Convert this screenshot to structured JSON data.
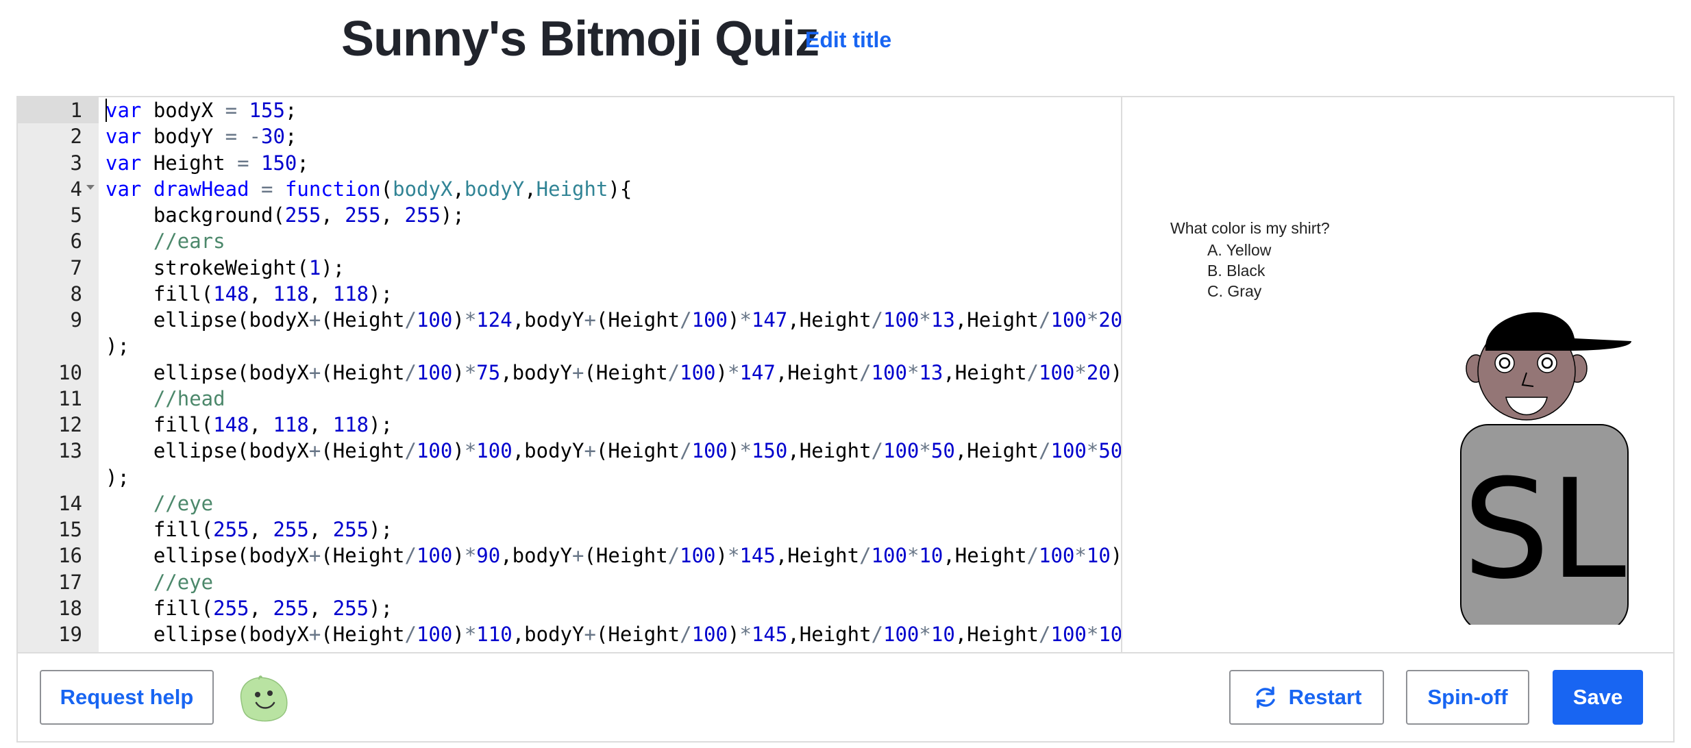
{
  "header": {
    "title": "Sunny's Bitmoji Quiz",
    "edit_title_label": "Edit title"
  },
  "editor": {
    "lines": [
      {
        "n": "1",
        "html": "<span class=\"kw\">var</span> bodyX <span class=\"op\">=</span> <span class=\"num\">155</span>;"
      },
      {
        "n": "2",
        "html": "<span class=\"kw\">var</span> bodyY <span class=\"op\">=</span> <span class=\"op\">-</span><span class=\"num\">30</span>;"
      },
      {
        "n": "3",
        "html": "<span class=\"kw\">var</span> Height <span class=\"op\">=</span> <span class=\"num\">150</span>;"
      },
      {
        "n": "4",
        "html": "<span class=\"kw\">var</span> <span class=\"kw\">drawHead</span> <span class=\"op\">=</span> <span class=\"kw\">function</span>(<span class=\"param\">bodyX</span>,<span class=\"param\">bodyY</span>,<span class=\"param\">Height</span>){"
      },
      {
        "n": "5",
        "html": "    background(<span class=\"num\">255</span>, <span class=\"num\">255</span>, <span class=\"num\">255</span>);"
      },
      {
        "n": "6",
        "html": "    <span class=\"cmt\">//ears</span>"
      },
      {
        "n": "7",
        "html": "    strokeWeight(<span class=\"num\">1</span>);"
      },
      {
        "n": "8",
        "html": "    fill(<span class=\"num\">148</span>, <span class=\"num\">118</span>, <span class=\"num\">118</span>);"
      },
      {
        "n": "9",
        "html": "    ellipse(bodyX<span class=\"op\">+</span>(Height<span class=\"op\">/</span><span class=\"num\">100</span>)<span class=\"op\">*</span><span class=\"num\">124</span>,bodyY<span class=\"op\">+</span>(Height<span class=\"op\">/</span><span class=\"num\">100</span>)<span class=\"op\">*</span><span class=\"num\">147</span>,Height<span class=\"op\">/</span><span class=\"num\">100</span><span class=\"op\">*</span><span class=\"num\">13</span>,Height<span class=\"op\">/</span><span class=\"num\">100</span><span class=\"op\">*</span><span class=\"num\">20</span>",
        "wrap": ");"
      },
      {
        "n": "10",
        "html": "    ellipse(bodyX<span class=\"op\">+</span>(Height<span class=\"op\">/</span><span class=\"num\">100</span>)<span class=\"op\">*</span><span class=\"num\">75</span>,bodyY<span class=\"op\">+</span>(Height<span class=\"op\">/</span><span class=\"num\">100</span>)<span class=\"op\">*</span><span class=\"num\">147</span>,Height<span class=\"op\">/</span><span class=\"num\">100</span><span class=\"op\">*</span><span class=\"num\">13</span>,Height<span class=\"op\">/</span><span class=\"num\">100</span><span class=\"op\">*</span><span class=\"num\">20</span>);"
      },
      {
        "n": "11",
        "html": "    <span class=\"cmt\">//head</span>"
      },
      {
        "n": "12",
        "html": "    fill(<span class=\"num\">148</span>, <span class=\"num\">118</span>, <span class=\"num\">118</span>);"
      },
      {
        "n": "13",
        "html": "    ellipse(bodyX<span class=\"op\">+</span>(Height<span class=\"op\">/</span><span class=\"num\">100</span>)<span class=\"op\">*</span><span class=\"num\">100</span>,bodyY<span class=\"op\">+</span>(Height<span class=\"op\">/</span><span class=\"num\">100</span>)<span class=\"op\">*</span><span class=\"num\">150</span>,Height<span class=\"op\">/</span><span class=\"num\">100</span><span class=\"op\">*</span><span class=\"num\">50</span>,Height<span class=\"op\">/</span><span class=\"num\">100</span><span class=\"op\">*</span><span class=\"num\">50</span>",
        "wrap": ");"
      },
      {
        "n": "14",
        "html": "    <span class=\"cmt\">//eye</span>"
      },
      {
        "n": "15",
        "html": "    fill(<span class=\"num\">255</span>, <span class=\"num\">255</span>, <span class=\"num\">255</span>);"
      },
      {
        "n": "16",
        "html": "    ellipse(bodyX<span class=\"op\">+</span>(Height<span class=\"op\">/</span><span class=\"num\">100</span>)<span class=\"op\">*</span><span class=\"num\">90</span>,bodyY<span class=\"op\">+</span>(Height<span class=\"op\">/</span><span class=\"num\">100</span>)<span class=\"op\">*</span><span class=\"num\">145</span>,Height<span class=\"op\">/</span><span class=\"num\">100</span><span class=\"op\">*</span><span class=\"num\">10</span>,Height<span class=\"op\">/</span><span class=\"num\">100</span><span class=\"op\">*</span><span class=\"num\">10</span>);"
      },
      {
        "n": "17",
        "html": "    <span class=\"cmt\">//eye</span>"
      },
      {
        "n": "18",
        "html": "    fill(<span class=\"num\">255</span>, <span class=\"num\">255</span>, <span class=\"num\">255</span>);"
      },
      {
        "n": "19",
        "html": "    ellipse(bodyX<span class=\"op\">+</span>(Height<span class=\"op\">/</span><span class=\"num\">100</span>)<span class=\"op\">*</span><span class=\"num\">110</span>,bodyY<span class=\"op\">+</span>(Height<span class=\"op\">/</span><span class=\"num\">100</span>)<span class=\"op\">*</span><span class=\"num\">145</span>,Height<span class=\"op\">/</span><span class=\"num\">100</span><span class=\"op\">*</span><span class=\"num\">10</span>,Height<span class=\"op\">/</span><span class=\"num\">100</span><span class=\"op\">*</span><span class=\"num\">10</span>"
      }
    ]
  },
  "preview": {
    "question": "What color is my shirt?",
    "options": [
      "A. Yellow",
      "B. Black",
      "C. Gray"
    ],
    "shirt_text": "SL"
  },
  "footer": {
    "request_help_label": "Request help",
    "restart_label": "Restart",
    "spinoff_label": "Spin-off",
    "save_label": "Save"
  },
  "colors": {
    "accent": "#1865f2",
    "title": "#21242c",
    "skin": "#947676",
    "shirt": "#999999"
  }
}
